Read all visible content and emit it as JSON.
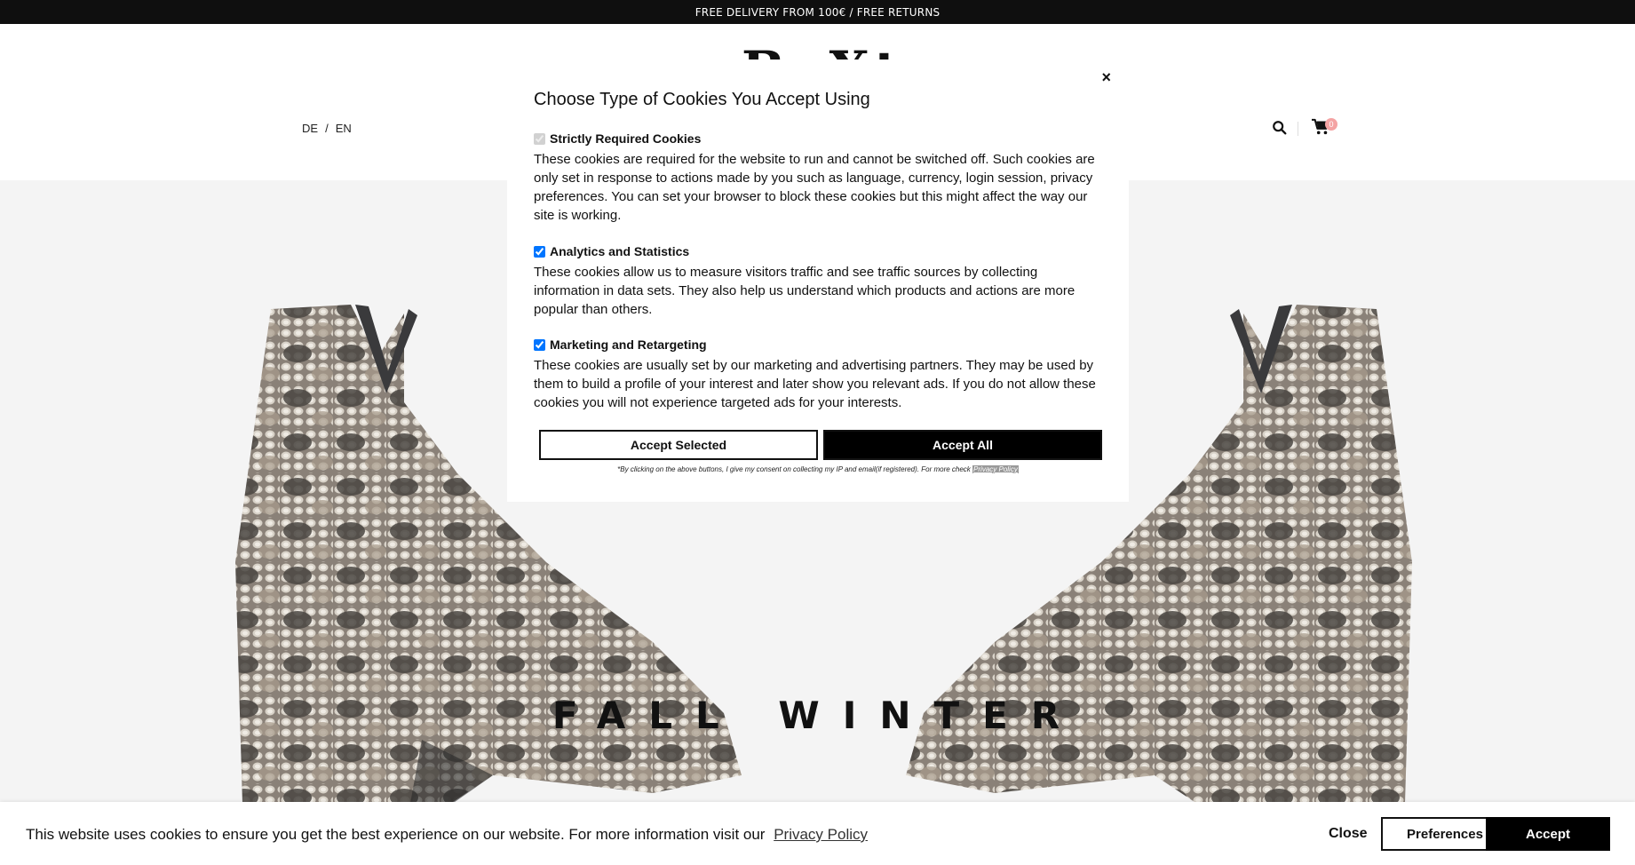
{
  "topbar": {
    "text": "FREE DELIVERY FROM 100€ / FREE RETURNS"
  },
  "header": {
    "logo_text": "BaXta",
    "languages": [
      "DE",
      "EN"
    ],
    "lang_separator": "/",
    "cart_count": "0",
    "icons": {
      "search": "search-icon",
      "cart": "cart-icon"
    }
  },
  "hero": {
    "title": "FALL WINTER"
  },
  "cookie_modal": {
    "close_label": "×",
    "title": "Choose Type of Cookies You Accept Using",
    "groups": [
      {
        "label": "Strictly Required Cookies",
        "checked": true,
        "disabled": true,
        "description": "These cookies are required for the website to run and cannot be switched off. Such cookies are only set in response to actions made by you such as language, currency, login session, privacy preferences. You can set your browser to block these cookies but this might affect the way our site is working."
      },
      {
        "label": "Analytics and Statistics",
        "checked": true,
        "disabled": false,
        "description": "These cookies allow us to measure visitors traffic and see traffic sources by collecting information in data sets. They also help us understand which products and actions are more popular than others."
      },
      {
        "label": "Marketing and Retargeting",
        "checked": true,
        "disabled": false,
        "description": "These cookies are usually set by our marketing and advertising partners. They may be used by them to build a profile of your interest and later show you relevant ads. If you do not allow these cookies you will not experience targeted ads for your interests."
      }
    ],
    "accept_selected_label": "Accept Selected",
    "accept_all_label": "Accept All",
    "consent_note": "*By clicking on the above buttons, I give my consent on collecting my IP and email(if registered). For more check",
    "privacy_link": "Privacy Policy"
  },
  "cookie_bar": {
    "message": "This website uses cookies to ensure you get the best experience on our website. For more information visit our",
    "privacy_link": "Privacy Policy",
    "close_label": "Close",
    "preferences_label": "Preferences",
    "accept_label": "Accept"
  },
  "colors": {
    "topbar_bg": "#0f0f0f",
    "hero_bg": "#f4f4f4",
    "button_dark": "#000000",
    "cart_badge": "#f4a3a3"
  }
}
